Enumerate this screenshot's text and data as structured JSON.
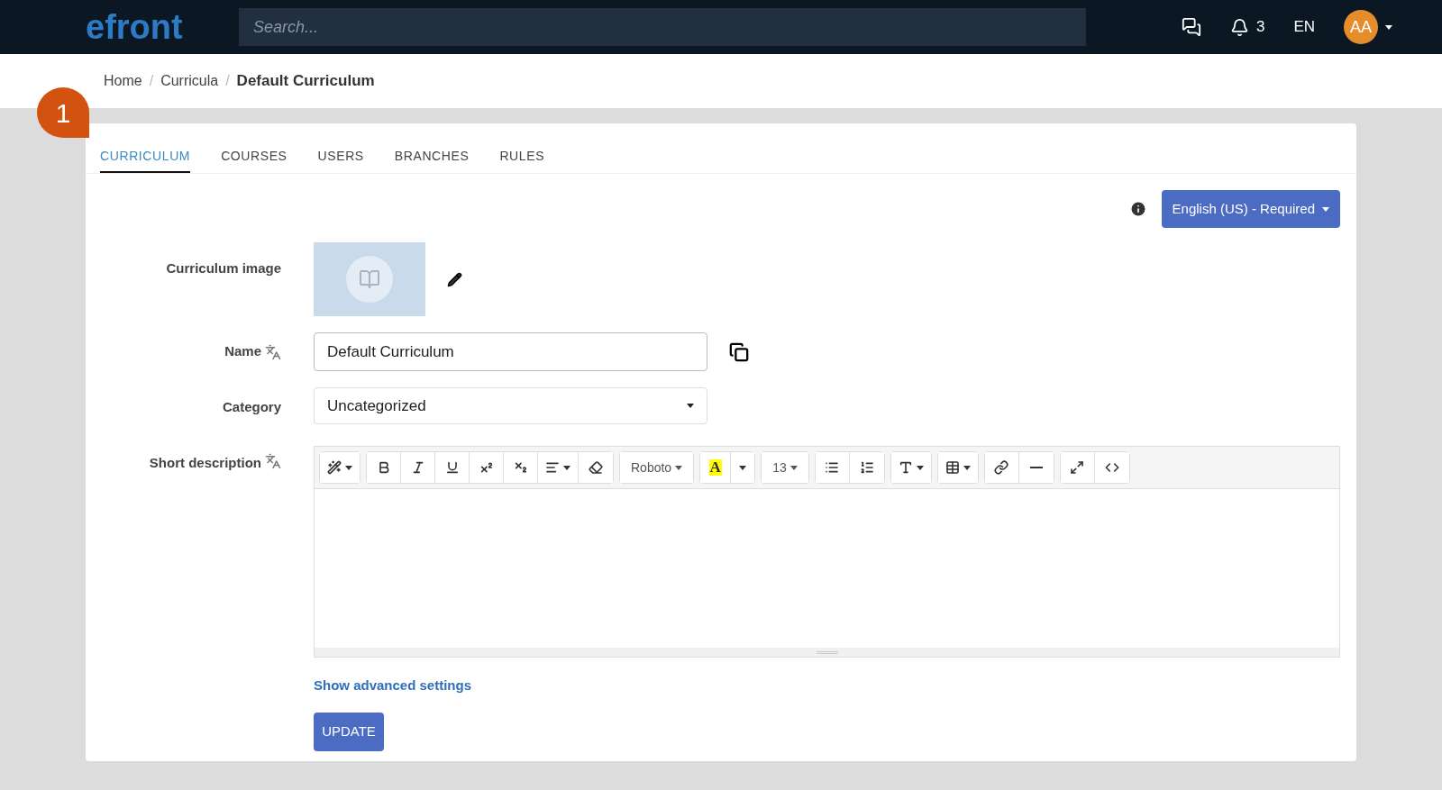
{
  "header": {
    "logo": "efront",
    "search": {
      "placeholder": "Search..."
    },
    "notifications": "3",
    "language": "EN",
    "avatar": "AA"
  },
  "breadcrumb_separator": "/",
  "breadcrumb": [
    {
      "label": "Home",
      "current": false
    },
    {
      "label": "Curricula",
      "current": false
    },
    {
      "label": "Default Curriculum",
      "current": true
    }
  ],
  "callout": "1",
  "tabs": [
    {
      "label": "CURRICULUM",
      "selected": true
    },
    {
      "label": "COURSES",
      "selected": false
    },
    {
      "label": "USERS",
      "selected": false
    },
    {
      "label": "BRANCHES",
      "selected": false
    },
    {
      "label": "RULES",
      "selected": false
    }
  ],
  "language_button": "English (US) - Required",
  "form": {
    "image_label": "Curriculum image",
    "name_label": "Name",
    "name_value": "Default Curriculum",
    "category_label": "Category",
    "category_value": "Uncategorized",
    "description_label": "Short description"
  },
  "toolbar": [
    [
      {
        "kind": "magic"
      }
    ],
    [
      {
        "kind": "bold"
      },
      {
        "kind": "italic"
      },
      {
        "kind": "underline"
      },
      {
        "kind": "superscript"
      },
      {
        "kind": "subscript"
      },
      {
        "kind": "align"
      },
      {
        "kind": "eraser"
      }
    ],
    [
      {
        "kind": "font",
        "label": "Roboto"
      }
    ],
    [
      {
        "kind": "color",
        "label": "A"
      },
      {
        "kind": "caret"
      }
    ],
    [
      {
        "kind": "size",
        "label": "13"
      }
    ],
    [
      {
        "kind": "bullets"
      },
      {
        "kind": "numbers"
      }
    ],
    [
      {
        "kind": "lineheight"
      }
    ],
    [
      {
        "kind": "table"
      }
    ],
    [
      {
        "kind": "link"
      },
      {
        "kind": "rule"
      }
    ],
    [
      {
        "kind": "fullscreen"
      },
      {
        "kind": "code"
      }
    ]
  ],
  "advanced_link": "Show advanced settings",
  "submit": "UPDATE"
}
